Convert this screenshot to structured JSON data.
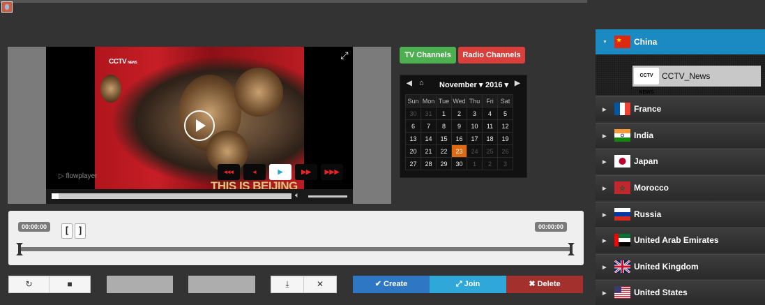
{
  "player": {
    "watermark": "CCTV",
    "watermark_sub": "NEWS",
    "brand": "flowplayer",
    "caption": "THIS IS BEIJING",
    "speed_buttons": [
      {
        "name": "slowest-button",
        "glyph": "◂◂◂"
      },
      {
        "name": "slow-button",
        "glyph": "◂"
      },
      {
        "name": "normal-speed-button",
        "glyph": "▶"
      },
      {
        "name": "fast-button",
        "glyph": "▶▶"
      },
      {
        "name": "fastest-button",
        "glyph": "▶▶▶"
      }
    ],
    "progress_fraction": 0.03,
    "volume_fraction": 1.0
  },
  "channels": {
    "tv_label": "TV Channels",
    "radio_label": "Radio Channels",
    "tv_color": "#4caf50",
    "radio_color": "#d9403b"
  },
  "calendar": {
    "month": "November",
    "year": "2016",
    "weekdays": [
      "Sun",
      "Mon",
      "Tue",
      "Wed",
      "Thu",
      "Fri",
      "Sat"
    ],
    "weeks": [
      [
        "30",
        "31",
        "1",
        "2",
        "3",
        "4",
        "5"
      ],
      [
        "6",
        "7",
        "8",
        "9",
        "10",
        "11",
        "12"
      ],
      [
        "13",
        "14",
        "15",
        "16",
        "17",
        "18",
        "19"
      ],
      [
        "20",
        "21",
        "22",
        "23",
        "24",
        "25",
        "26"
      ],
      [
        "27",
        "28",
        "29",
        "30",
        "1",
        "2",
        "3"
      ]
    ],
    "today": "23",
    "today_color": "#e06a12"
  },
  "trimmer": {
    "start_time": "00:00:00",
    "end_time": "00:00:00",
    "mark_in": "[",
    "mark_out": "]"
  },
  "actions": {
    "refresh_icon": "↻",
    "stop_icon": "■",
    "download_icon": "⤓",
    "clear_icon": "✕",
    "create_label": "✔ Create",
    "join_label": "⤢ Join",
    "delete_label": "✖ Delete",
    "create_color": "#2e77c4",
    "join_color": "#2fa7d8",
    "delete_color": "#a3302c"
  },
  "sidebar": {
    "countries": [
      {
        "name": "China",
        "open": true
      },
      {
        "name": "France"
      },
      {
        "name": "India"
      },
      {
        "name": "Japan"
      },
      {
        "name": "Morocco"
      },
      {
        "name": "Russia"
      },
      {
        "name": "United Arab Emirates"
      },
      {
        "name": "United Kingdom"
      },
      {
        "name": "United States"
      }
    ],
    "open_channels": [
      {
        "logo": "CCTV NEWS",
        "name": "CCTV_News"
      }
    ],
    "accent": "#1b8ac2"
  }
}
